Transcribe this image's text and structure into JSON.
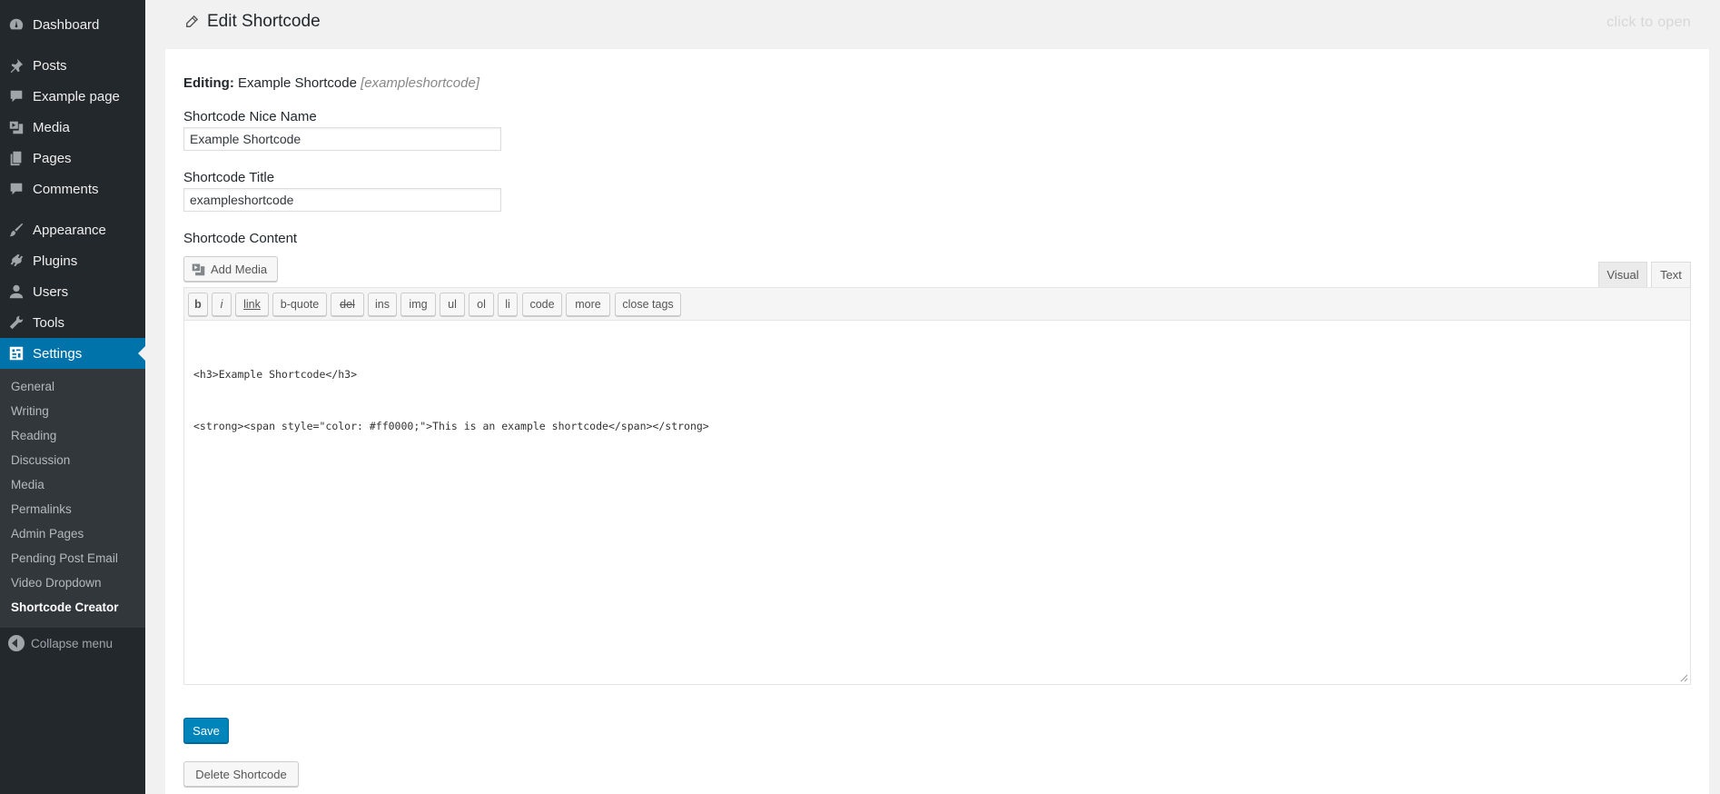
{
  "sidebar": {
    "items": [
      {
        "label": "Dashboard",
        "icon": "dashboard-icon"
      },
      {
        "label": "Posts",
        "icon": "pin-icon"
      },
      {
        "label": "Example page",
        "icon": "speech-bubble-icon"
      },
      {
        "label": "Media",
        "icon": "media-icon"
      },
      {
        "label": "Pages",
        "icon": "pages-icon"
      },
      {
        "label": "Comments",
        "icon": "comment-icon"
      },
      {
        "label": "Appearance",
        "icon": "paintbrush-icon"
      },
      {
        "label": "Plugins",
        "icon": "plug-icon"
      },
      {
        "label": "Users",
        "icon": "user-icon"
      },
      {
        "label": "Tools",
        "icon": "wrench-icon"
      },
      {
        "label": "Settings",
        "icon": "settings-icon"
      }
    ],
    "submenu": [
      "General",
      "Writing",
      "Reading",
      "Discussion",
      "Media",
      "Permalinks",
      "Admin Pages",
      "Pending Post Email",
      "Video Dropdown",
      "Shortcode Creator"
    ],
    "collapse_label": "Collapse menu"
  },
  "header": {
    "title": "Edit Shortcode",
    "right_hint": "click to open"
  },
  "form": {
    "editing_label": "Editing:",
    "editing_name": "Example Shortcode",
    "editing_slug": "[exampleshortcode]",
    "nice_name_label": "Shortcode Nice Name",
    "nice_name_value": "Example Shortcode",
    "title_label": "Shortcode Title",
    "title_value": "exampleshortcode",
    "content_label": "Shortcode Content",
    "add_media_label": "Add Media",
    "tab_visual": "Visual",
    "tab_text": "Text",
    "toolbar": [
      "b",
      "i",
      "link",
      "b-quote",
      "del",
      "ins",
      "img",
      "ul",
      "ol",
      "li",
      "code",
      "more",
      "close tags"
    ],
    "content_lines": [
      "<h3>Example Shortcode</h3>",
      "<strong><span style=\"color: #ff0000;\">This is an example shortcode</span></strong>"
    ],
    "save_label": "Save",
    "delete_label": "Delete Shortcode"
  },
  "colors": {
    "sidebar_bg": "#23282d",
    "submenu_bg": "#32373c",
    "active_menu": "#0073aa",
    "primary_button": "#0085ba"
  }
}
